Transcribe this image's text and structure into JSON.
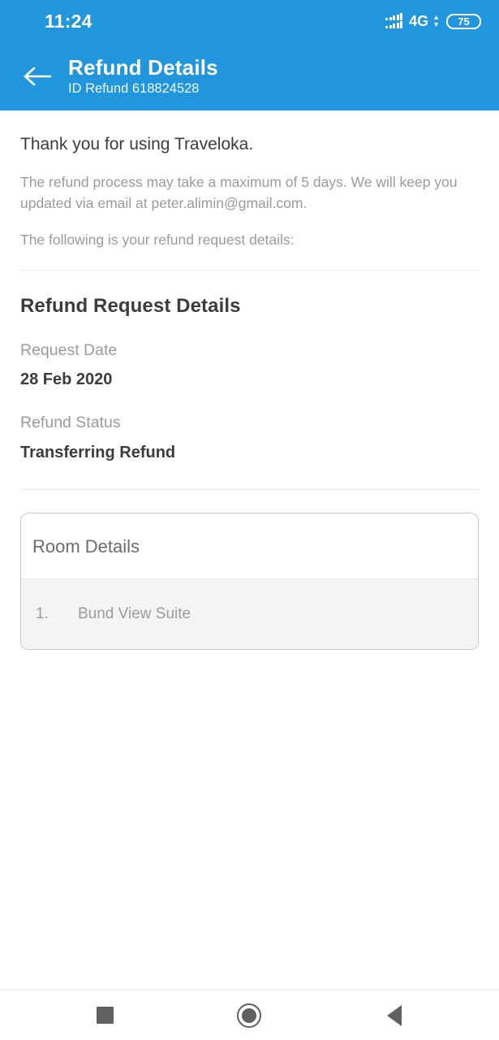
{
  "status_bar": {
    "time": "11:24",
    "network_type": "4G",
    "battery_level": "75",
    "signal_icon": "signal-bars-dual-icon",
    "data_arrows_icon": "data-transfer-arrows-icon",
    "battery_icon": "battery-icon"
  },
  "app_bar": {
    "back_icon": "back-arrow-icon",
    "title": "Refund Details",
    "subtitle": "ID Refund 618824528"
  },
  "intro": {
    "heading": "Thank you for using Traveloka.",
    "paragraph_1": "The refund process may take a maximum of 5 days. We will keep you updated via email at peter.alimin@gmail.com.",
    "paragraph_2": "The following is your refund request details:"
  },
  "refund_request": {
    "section_title": "Refund Request Details",
    "fields": [
      {
        "label": "Request Date",
        "value": "28 Feb 2020"
      },
      {
        "label": "Refund Status",
        "value": "Transferring Refund"
      }
    ]
  },
  "room_card": {
    "title": "Room Details",
    "rows": [
      {
        "index": "1.",
        "name": "Bund View Suite"
      }
    ]
  },
  "nav_bar": {
    "recents_icon": "square-recents-icon",
    "home_icon": "circle-home-icon",
    "back_icon": "triangle-back-icon"
  },
  "colors": {
    "header_blue": "#2196DC",
    "page_background": "#ffffff",
    "primary_text": "#3c3c3c",
    "muted_text": "#9b9b9b",
    "card_border": "#c9c9c9",
    "row_background": "#f4f4f4",
    "divider": "#ececec",
    "nav_icon": "#606060"
  }
}
